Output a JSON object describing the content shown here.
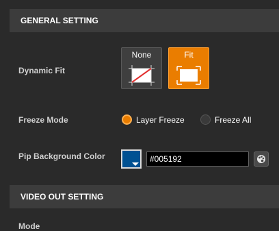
{
  "general": {
    "header": "GENERAL SETTING",
    "dynamic_fit": {
      "label": "Dynamic Fit",
      "options": [
        {
          "label": "None",
          "icon": "no-fit-icon",
          "selected": false
        },
        {
          "label": "Fit",
          "icon": "fit-screen-icon",
          "selected": true
        }
      ]
    },
    "freeze_mode": {
      "label": "Freeze Mode",
      "options": [
        {
          "label": "Layer Freeze",
          "selected": true
        },
        {
          "label": "Freeze All",
          "selected": false
        }
      ]
    },
    "pip_background": {
      "label": "Pip Background Color",
      "value": "#005192",
      "swatch_color": "#005192",
      "palette_icon": "color-palette-icon"
    }
  },
  "video_out": {
    "header": "VIDEO OUT SETTING",
    "mode_label": "Mode"
  },
  "colors": {
    "accent": "#ea7d00",
    "background": "#2a2a2a",
    "header_bg": "#3c3c3c"
  }
}
